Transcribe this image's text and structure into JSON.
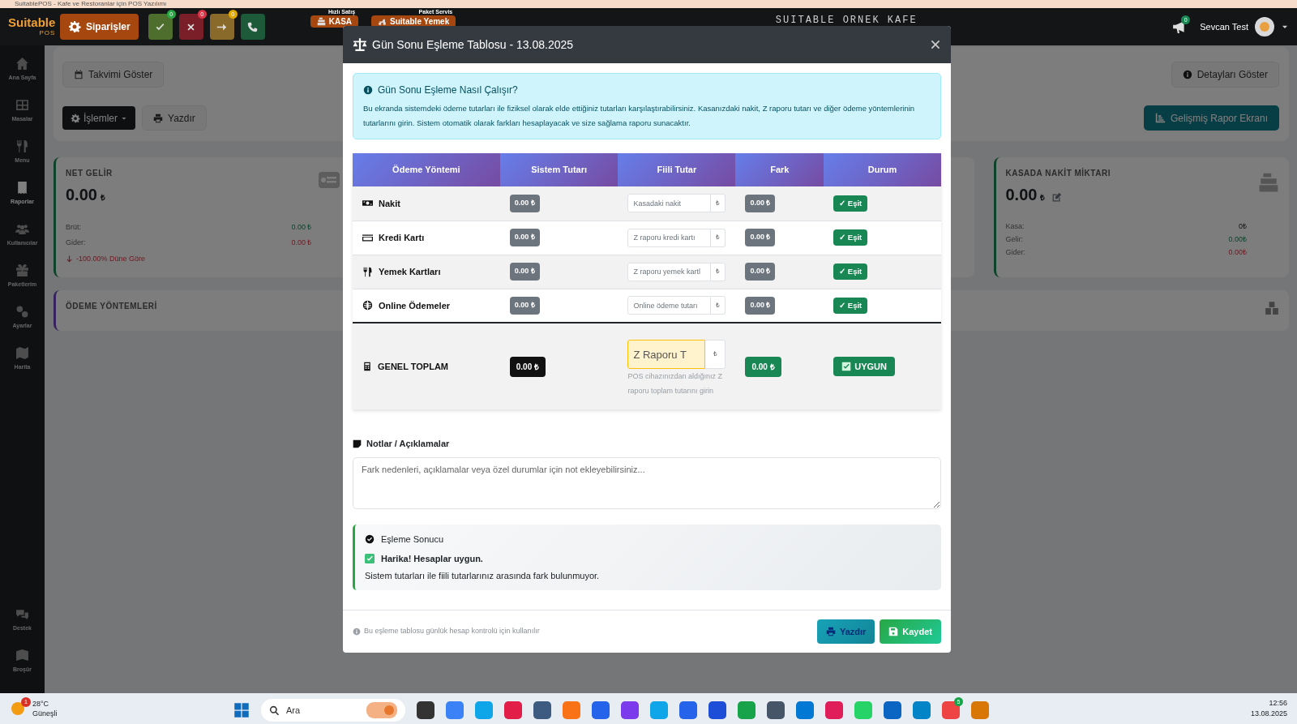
{
  "browser_title": "SuitablePOS - Kafe ve Restoranlar için POS Yazılımı",
  "navbar": {
    "logo": "Suitable",
    "logo_sub": "POS",
    "orders_button": "Siparişler",
    "status_buttons": [
      {
        "kind": "check",
        "badge": "0"
      },
      {
        "kind": "cancel",
        "badge": "0"
      },
      {
        "kind": "forward",
        "badge": "0"
      },
      {
        "kind": "phone"
      }
    ],
    "quick_buttons": [
      {
        "kind": "register",
        "caption": "Hızlı Satış",
        "label": "KASA"
      },
      {
        "kind": "delivery",
        "caption": "Paket Servis",
        "label": "Suitable Yemek"
      }
    ],
    "venue": "SUITABLE ORNEK KAFE",
    "notifications_badge": "0",
    "user": "Sevcan Test"
  },
  "sidebar": {
    "items": [
      {
        "kind": "home",
        "label": "Ana Sayfa",
        "selected": false
      },
      {
        "kind": "tables",
        "label": "Masalar",
        "selected": false
      },
      {
        "kind": "menu",
        "label": "Menu",
        "selected": false
      },
      {
        "kind": "reports",
        "label": "Raporlar",
        "selected": true
      },
      {
        "kind": "users",
        "label": "Kullanıcılar",
        "selected": false
      },
      {
        "kind": "packages",
        "label": "Paketlerim",
        "selected": false
      },
      {
        "kind": "settings",
        "label": "Ayarlar",
        "selected": false
      },
      {
        "kind": "map",
        "label": "Harita",
        "selected": false
      }
    ],
    "bottom_items": [
      {
        "kind": "support",
        "label": "Destek",
        "selected": false
      },
      {
        "kind": "brochure",
        "label": "Broşür",
        "selected": false
      }
    ]
  },
  "toolbar": {
    "calendar_button": "Takvimi Göster",
    "details_button": "Detayları Göster",
    "actions_button": "İşlemler",
    "print_button": "Yazdır",
    "report_button": "Gelişmiş Rapor Ekranı"
  },
  "stat_cards": [
    {
      "kind": "net",
      "title": "NET GELİR",
      "value": "0.00",
      "currency": "₺",
      "rows": [
        {
          "kind": "positive",
          "label": "Brüt:",
          "value": "0.00 ₺"
        },
        {
          "kind": "negative",
          "label": "Gider:",
          "value": "0.00 ₺"
        }
      ],
      "trend": "-100.00% Düne Göre"
    },
    {
      "kind": "cash",
      "title": "KASADA NAKİT MİKTARI",
      "value": "0.00",
      "currency": "₺",
      "rows": [
        {
          "kind": "neutral",
          "label": "Kasa:",
          "value": "0₺"
        },
        {
          "kind": "positive",
          "label": "Gelir:",
          "value": "0.00₺"
        },
        {
          "kind": "negative",
          "label": "Gider:",
          "value": "0.00₺"
        }
      ]
    }
  ],
  "payment_panel": {
    "title": "ÖDEME YÖNTEMLERİ"
  },
  "modal": {
    "title": "Gün Sonu Eşleme Tablosu - 13.08.2025",
    "info": {
      "title": "Gün Sonu Eşleme Nasıl Çalışır?",
      "text": "Bu ekranda sistemdeki ödeme tutarları ile fiziksel olarak elde ettiğiniz tutarları karşılaştırabilirsiniz. Kasanızdaki nakit, Z raporu tutarı ve diğer ödeme yöntemlerinin tutarlarını girin. Sistem otomatik olarak farkları hesaplayacak ve size sağlama raporu sunacaktır."
    },
    "columns": [
      "Ödeme Yöntemi",
      "Sistem Tutarı",
      "Fiili Tutar",
      "Fark",
      "Durum"
    ],
    "rows": [
      {
        "kind": "cash",
        "method": "Nakit",
        "system": "0.00 ₺",
        "placeholder": "Kasadaki nakit",
        "currency": "₺",
        "difference": "0.00 ₺",
        "status": "✓ Eşit",
        "matched": true
      },
      {
        "kind": "card",
        "method": "Kredi Kartı",
        "system": "0.00 ₺",
        "placeholder": "Z raporu kredi kartı",
        "currency": "₺",
        "difference": "0.00 ₺",
        "status": "✓ Eşit",
        "matched": true
      },
      {
        "kind": "meal",
        "method": "Yemek Kartları",
        "system": "0.00 ₺",
        "placeholder": "Z raporu yemek kartl",
        "currency": "₺",
        "difference": "0.00 ₺",
        "status": "✓ Eşit",
        "matched": true
      },
      {
        "kind": "online",
        "method": "Online Ödemeler",
        "system": "0.00 ₺",
        "placeholder": "Online ödeme tutarı",
        "currency": "₺",
        "difference": "0.00 ₺",
        "status": "✓ Eşit",
        "matched": true
      }
    ],
    "total": {
      "label": "GENEL TOPLAM",
      "system": "0.00 ₺",
      "placeholder": "Z Raporu T",
      "currency": "₺",
      "hint": "POS cihazınızdan aldığınız Z raporu toplam tutarını girin",
      "difference": "0.00 ₺",
      "status": "UYGUN",
      "matched": true
    },
    "notes": {
      "label": "Notlar / Açıklamalar",
      "placeholder": "Fark nedenleri, açıklamalar veya özel durumlar için not ekleyebilirsiniz..."
    },
    "result": {
      "title": "Eşleme Sonucu",
      "headline": "Harika! Hesaplar uygun.",
      "text": "Sistem tutarları ile fiili tutarlarınız arasında fark bulunmuyor.",
      "matched": true
    },
    "footer_note": "Bu eşleme tablosu günlük hesap kontrolü için kullanılır",
    "buttons": [
      {
        "kind": "print",
        "label": "Yazdır"
      },
      {
        "kind": "save",
        "label": "Kaydet"
      }
    ]
  },
  "taskbar": {
    "weather_badge": "1",
    "temperature": "28°C",
    "weather": "Güneşli",
    "search": "Ara",
    "chrome_badge": "5",
    "time": "12:56",
    "date": "13.08.2025"
  }
}
